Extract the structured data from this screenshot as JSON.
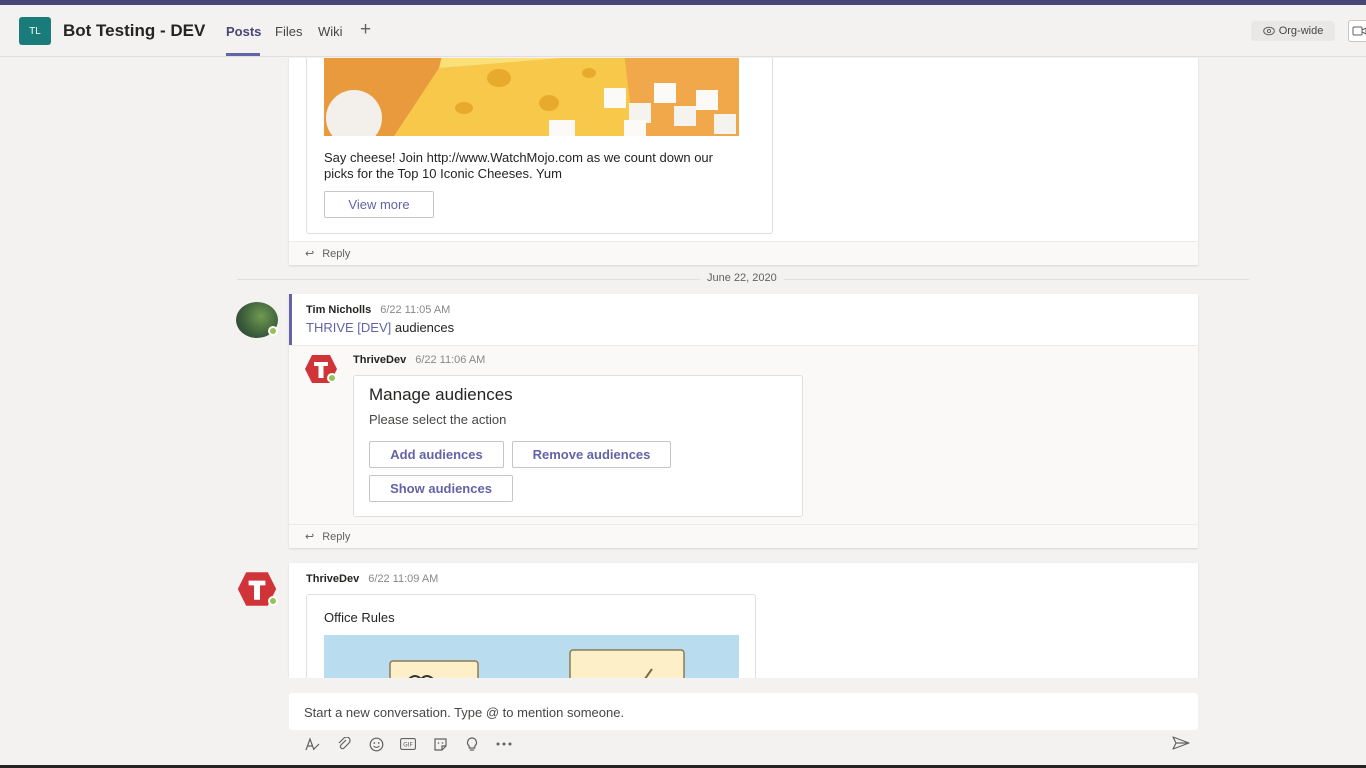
{
  "header": {
    "team_initials": "TL",
    "team_title": "Bot Testing - DEV",
    "tabs": [
      {
        "label": "Posts",
        "active": true
      },
      {
        "label": "Files",
        "active": false
      },
      {
        "label": "Wiki",
        "active": false
      }
    ],
    "add_tab_icon": "plus-icon",
    "org_wide_label": "Org-wide"
  },
  "feed": {
    "post1": {
      "card_text": "Say cheese! Join http://www.WatchMojo.com as we count down our picks for the Top 10 Iconic Cheeses. Yum",
      "view_more_label": "View more",
      "reply_label": "Reply"
    },
    "date_divider": "June 22, 2020",
    "post2": {
      "author": "Tim Nicholls",
      "time": "6/22 11:05 AM",
      "mention": "THRIVE [DEV]",
      "text": "audiences",
      "reply": {
        "author": "ThriveDev",
        "time": "6/22 11:06 AM",
        "card_title": "Manage audiences",
        "card_subtitle": "Please select the action",
        "buttons": [
          "Add audiences",
          "Remove audiences",
          "Show audiences"
        ]
      },
      "reply_label": "Reply"
    },
    "post3": {
      "author": "ThriveDev",
      "time": "6/22 11:09 AM",
      "card_title": "Office Rules"
    }
  },
  "compose": {
    "placeholder": "Start a new conversation. Type @ to mention someone."
  },
  "colors": {
    "accent": "#6264a7",
    "top_bar": "#464775",
    "team_avatar": "#1a7b7b",
    "bot_red": "#d13438",
    "presence_green": "#92c353"
  }
}
